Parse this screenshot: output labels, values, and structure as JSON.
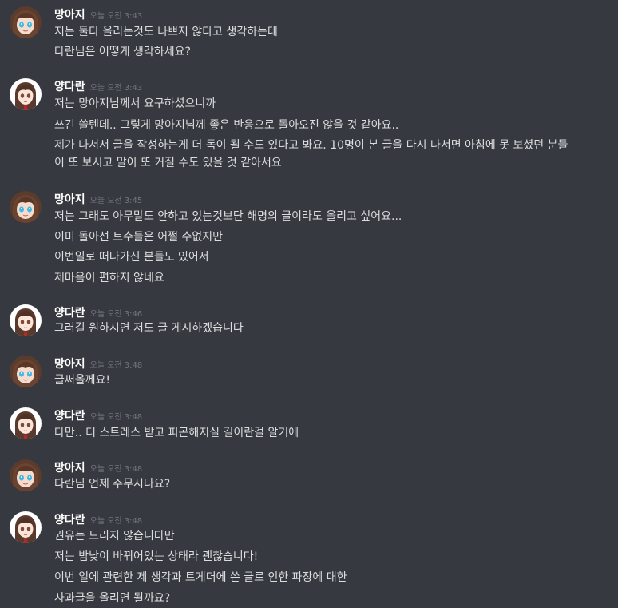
{
  "messages": [
    {
      "author": "망아지",
      "avatar": "avatar-mangaji",
      "timestamp": "오늘 오전 3:43",
      "lines": [
        "저는 둘다 올리는것도 나쁘지 않다고 생각하는데",
        "다란님은 어떻게 생각하세요?"
      ]
    },
    {
      "author": "양다란",
      "avatar": "avatar-yangdaran",
      "timestamp": "오늘 오전 3:43",
      "lines": [
        "저는 망아지님께서 요구하셨으니까",
        "쓰긴 쓸텐데.. 그렇게 망아지님께 좋은 반응으로 돌아오진 않을 것 같아요..",
        "제가 나서서 글을 작성하는게 더 독이 될 수도 있다고 봐요. 10명이 본 글을 다시 나서면 아침에 못 보셨던 분들이 또 보시고 말이 또 커질 수도 있을 것 같아서요"
      ]
    },
    {
      "author": "망아지",
      "avatar": "avatar-mangaji",
      "timestamp": "오늘 오전 3:45",
      "lines": [
        "저는 그래도 아무말도 안하고 있는것보단 해명의 글이라도 올리고 싶어요...",
        "이미 돌아선 트수들은 어쩔 수없지만",
        "이번일로 떠나가신 분들도 있어서",
        "제마음이 편하지 않네요"
      ]
    },
    {
      "author": "양다란",
      "avatar": "avatar-yangdaran",
      "timestamp": "오늘 오전 3:46",
      "lines": [
        "그러길 원하시면 저도 글 게시하겠습니다"
      ]
    },
    {
      "author": "망아지",
      "avatar": "avatar-mangaji",
      "timestamp": "오늘 오전 3:48",
      "lines": [
        "글써올께요!"
      ]
    },
    {
      "author": "양다란",
      "avatar": "avatar-yangdaran",
      "timestamp": "오늘 오전 3:48",
      "lines": [
        "다만.. 더 스트레스 받고 피곤해지실 길이란걸 알기에"
      ]
    },
    {
      "author": "망아지",
      "avatar": "avatar-mangaji",
      "timestamp": "오늘 오전 3:48",
      "lines": [
        "다란님 언제 주무시나요?"
      ]
    },
    {
      "author": "양다란",
      "avatar": "avatar-yangdaran",
      "timestamp": "오늘 오전 3:48",
      "lines": [
        "권유는 드리지 않습니다만",
        "저는 밤낮이 바뀌어있는 상태라 괜찮습니다!",
        "이번 일에 관련한 제 생각과 트게더에 쓴 글로 인한 파장에 대한",
        "사과글을 올리면 될까요?"
      ]
    }
  ],
  "colors": {
    "background": "#36393f",
    "username": "#ffffff",
    "message_text": "#dcddde",
    "timestamp": "#72767d"
  }
}
